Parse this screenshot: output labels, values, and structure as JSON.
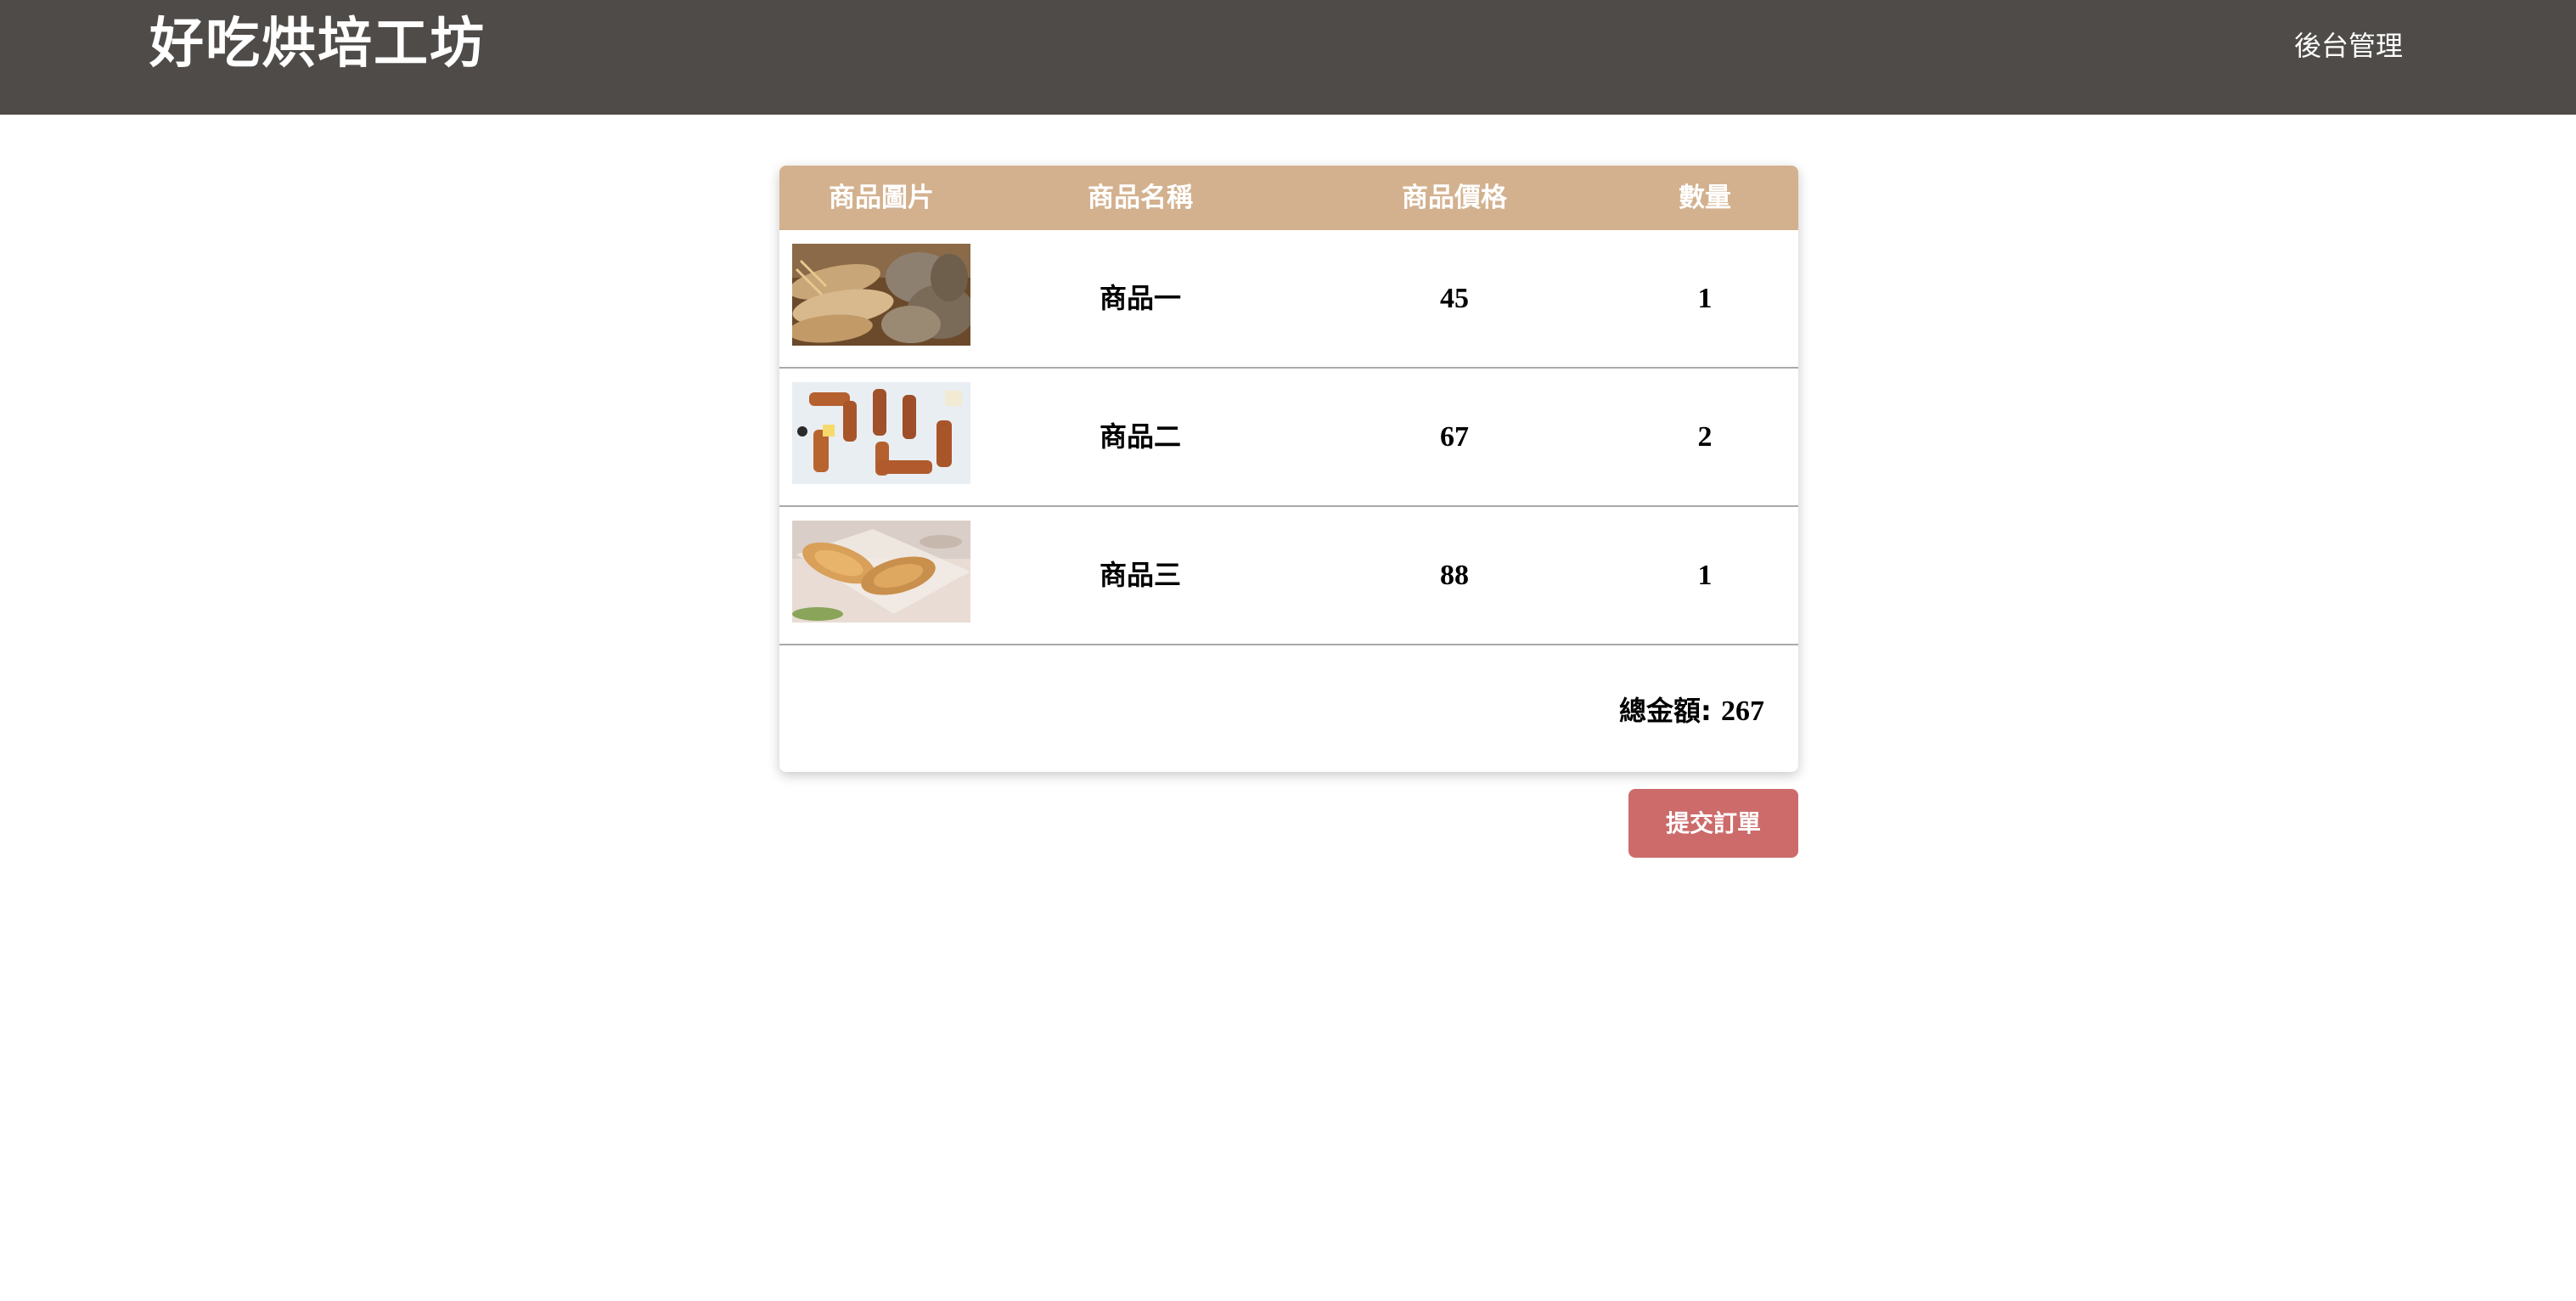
{
  "header": {
    "brand": "好吃烘培工坊",
    "admin_link": "後台管理",
    "background": "#4f4b48"
  },
  "cart": {
    "columns": {
      "image": "商品圖片",
      "name": "商品名稱",
      "price": "商品價格",
      "quantity": "數量"
    },
    "header_color": "#d3b18f",
    "items": [
      {
        "image_icon": "bread-loaves-photo",
        "name": "商品一",
        "price": "45",
        "quantity": "1"
      },
      {
        "image_icon": "braided-bread-photo",
        "name": "商品二",
        "price": "67",
        "quantity": "2"
      },
      {
        "image_icon": "croissant-photo",
        "name": "商品三",
        "price": "88",
        "quantity": "1"
      }
    ],
    "total_label": "總金額:",
    "total_value": "267"
  },
  "actions": {
    "submit_label": "提交訂單",
    "submit_color": "#cd6b6b"
  }
}
